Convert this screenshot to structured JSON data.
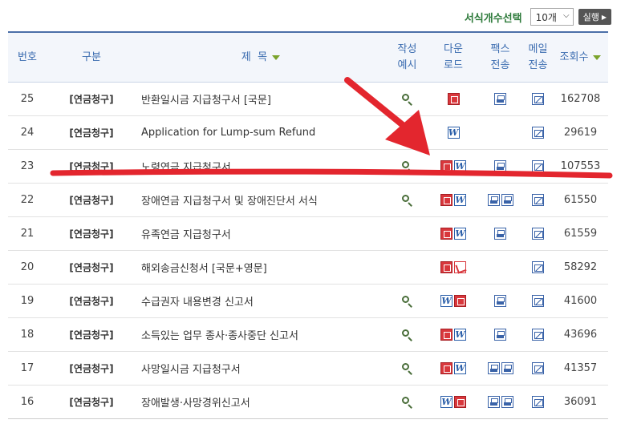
{
  "toolbar": {
    "count_label": "서식개수선택",
    "count_value": "10개",
    "run_label": "실행"
  },
  "headers": {
    "no": "번호",
    "type": "구분",
    "title": "제  목",
    "example": "작성\n예시",
    "download": "다운\n로드",
    "fax": "팩스\n전송",
    "mail": "메일\n전송",
    "views": "조회수"
  },
  "rows": [
    {
      "no": "25",
      "type": "[연금청구]",
      "title": "반환일시금 지급청구서 [국문]",
      "example": true,
      "downloads": [
        "hwp-icon"
      ],
      "fax": [
        "fax-icon"
      ],
      "mail": true,
      "views": "162708"
    },
    {
      "no": "24",
      "type": "[연금청구]",
      "title": "Application for Lump-sum Refund",
      "example": false,
      "downloads": [
        "word-icon"
      ],
      "fax": [],
      "mail": true,
      "views": "29619"
    },
    {
      "no": "23",
      "type": "[연금청구]",
      "title": "노령연금 지급청구서",
      "example": true,
      "downloads": [
        "hwp-icon",
        "word-icon"
      ],
      "fax": [
        "fax-icon"
      ],
      "mail": true,
      "views": "107553"
    },
    {
      "no": "22",
      "type": "[연금청구]",
      "title": "장애연금 지급청구서 및 장애진단서 서식",
      "example": true,
      "downloads": [
        "hwp-icon",
        "word-icon"
      ],
      "fax": [
        "fax-icon",
        "fax-icon"
      ],
      "mail": true,
      "views": "61550"
    },
    {
      "no": "21",
      "type": "[연금청구]",
      "title": "유족연금 지급청구서",
      "example": false,
      "downloads": [
        "hwp-icon",
        "word-icon"
      ],
      "fax": [
        "fax-icon"
      ],
      "mail": true,
      "views": "61559"
    },
    {
      "no": "20",
      "type": "[연금청구]",
      "title": "해외송금신청서 [국문+영문]",
      "example": false,
      "downloads": [
        "hwp-icon",
        "pdf-icon"
      ],
      "fax": [],
      "mail": true,
      "views": "58292"
    },
    {
      "no": "19",
      "type": "[연금청구]",
      "title": "수급권자 내용변경 신고서",
      "example": true,
      "downloads": [
        "word-icon",
        "hwp-icon"
      ],
      "fax": [
        "fax-icon"
      ],
      "mail": true,
      "views": "41600"
    },
    {
      "no": "18",
      "type": "[연금청구]",
      "title": "소득있는 업무 종사·종사중단 신고서",
      "example": true,
      "downloads": [
        "hwp-icon",
        "word-icon"
      ],
      "fax": [
        "fax-icon"
      ],
      "mail": true,
      "views": "43696"
    },
    {
      "no": "17",
      "type": "[연금청구]",
      "title": "사망일시금 지급청구서",
      "example": true,
      "downloads": [
        "hwp-icon",
        "word-icon"
      ],
      "fax": [
        "fax-icon",
        "fax-icon"
      ],
      "mail": true,
      "views": "41357"
    },
    {
      "no": "16",
      "type": "[연금청구]",
      "title": "장애발생·사망경위신고서",
      "example": true,
      "downloads": [
        "word-icon",
        "hwp-icon"
      ],
      "fax": [
        "fax-icon",
        "fax-icon"
      ],
      "mail": true,
      "views": "36091"
    }
  ],
  "colors": {
    "header_text": "#3b6cb0",
    "label_green": "#2d7a3a",
    "annotation_red": "#e3262e"
  }
}
